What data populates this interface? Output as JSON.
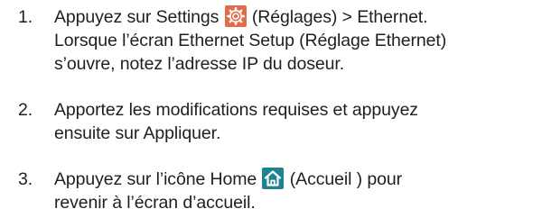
{
  "steps": [
    {
      "number": "1.",
      "text_before_icon": "Appuyez sur Settings ",
      "icon": "gear-icon",
      "text_after_icon": " (Réglages) > Ethernet.",
      "line2": "Lorsque l’écran Ethernet Setup (Réglage Ethernet)",
      "line3": "s’ouvre, notez l’adresse IP du doseur."
    },
    {
      "number": "2.",
      "line1": "Apportez les modifications requises et appuyez",
      "line2": "ensuite sur Appliquer."
    },
    {
      "number": "3.",
      "text_before_icon": "Appuyez sur l’icône Home ",
      "icon": "home-icon",
      "text_after_icon": " (Accueil ) pour",
      "line2": "revenir à l’écran d’accueil."
    }
  ],
  "colors": {
    "text": "#1f1f1f",
    "settings_icon_bg": "#e06c4c",
    "home_icon_bg": "#1e8291",
    "icon_fg": "#ffffff"
  }
}
